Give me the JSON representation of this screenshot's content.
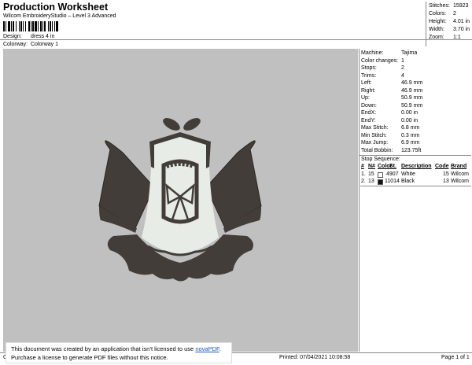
{
  "header": {
    "title": "Production Worksheet",
    "subtitle": "Wilcom EmbroideryStudio – Level 3 Advanced",
    "design_label": "Design:",
    "design_value": "dress 4 in",
    "colorway_label": "Colorway:",
    "colorway_value": "Colorway 1"
  },
  "stats": {
    "stitches_label": "Stitches:",
    "stitches": "15923",
    "colors_label": "Colors:",
    "colors": "2",
    "height_label": "Height:",
    "height": "4.01 in",
    "width_label": "Width:",
    "width": "3.70 in",
    "zoom_label": "Zoom:",
    "zoom": "1:1"
  },
  "info": {
    "machine_label": "Machine:",
    "machine": "Tajima",
    "color_changes_label": "Color changes:",
    "color_changes": "1",
    "stops_label": "Stops:",
    "stops": "2",
    "trims_label": "Trims:",
    "trims": "4",
    "left_label": "Left:",
    "left": "46.9 mm",
    "right_label": "Right:",
    "right": "46.9 mm",
    "up_label": "Up:",
    "up": "50.9 mm",
    "down_label": "Down:",
    "down": "50.9 mm",
    "endx_label": "EndX:",
    "endx": "0.00 in",
    "endy_label": "EndY:",
    "endy": "0.00 in",
    "max_stitch_label": "Max Stitch:",
    "max_stitch": "6.8 mm",
    "min_stitch_label": "Min Stitch:",
    "min_stitch": "0.3 mm",
    "max_jump_label": "Max Jump:",
    "max_jump": "6.9 mm",
    "total_bobbin_label": "Total Bobbin:",
    "total_bobbin": "123.75ft"
  },
  "stop_sequence": {
    "title": "Stop Sequence:",
    "columns": [
      "#",
      "N#",
      "Color",
      "St.",
      "Description",
      "Code",
      "Brand"
    ],
    "rows": [
      {
        "num": "1.",
        "n": "15",
        "swatch": "#ffffff",
        "st": "4907",
        "desc": "White",
        "code": "15",
        "brand": "Wilcom"
      },
      {
        "num": "2.",
        "n": "13",
        "swatch": "#111111",
        "st": "11014",
        "desc": "Black",
        "code": "13",
        "brand": "Wilcom"
      }
    ]
  },
  "footer": {
    "left": "Cr",
    "printed": "Printed: 07/04/2021 10:08:58",
    "page": "Page 1 of 1"
  },
  "notice": {
    "line1_prefix": "This document was created by an application that isn’t licensed to use ",
    "link": "novaPDF",
    "line1_suffix": ".",
    "line2": "Purchase a license to generate PDF files without this notice."
  },
  "colors": {
    "design_bg": "#c0c0c0",
    "thread_dark": "#423d38",
    "thread_light": "#e8ece6"
  }
}
